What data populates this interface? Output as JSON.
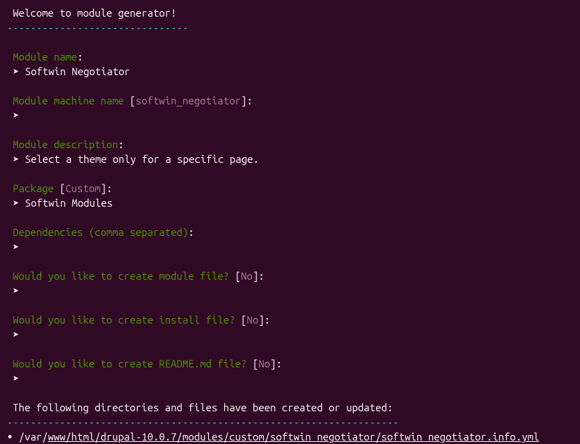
{
  "header": {
    "welcome": " Welcome to module generator!",
    "dashes": "-------------------------------"
  },
  "prompts": {
    "module_name": {
      "label": " Module name",
      "answer": "Softwin Negotiator"
    },
    "machine_name": {
      "label": " Module machine name ",
      "default": "softwin_negotiator",
      "answer": ""
    },
    "description": {
      "label": " Module description",
      "answer": "Select a theme only for a specific page."
    },
    "package": {
      "label": " Package ",
      "default": "Custom",
      "answer": "Softwin Modules"
    },
    "dependencies": {
      "label": " Dependencies (comma separated)",
      "answer": ""
    },
    "module_file": {
      "label": " Would you like to create module file? ",
      "default": "No",
      "answer": ""
    },
    "install_file": {
      "label": " Would you like to create install file? ",
      "default": "No",
      "answer": ""
    },
    "readme_file": {
      "label": " Would you like to create README.md file? ",
      "default": "No",
      "answer": ""
    }
  },
  "footer": {
    "message": " The following directories and files have been created or updated:",
    "dashes": "-------------------------------------------------------------------",
    "bullet": "• ",
    "path_prefix": "/var/",
    "path_underlined": "www/html/drupal-10.0.7/modules/custom/softwin negotiator/softwin negotiator.info.yml"
  },
  "symbols": {
    "arrow": " ➤ ",
    "colon": ":",
    "lbracket": "[",
    "rbracket": "]"
  }
}
